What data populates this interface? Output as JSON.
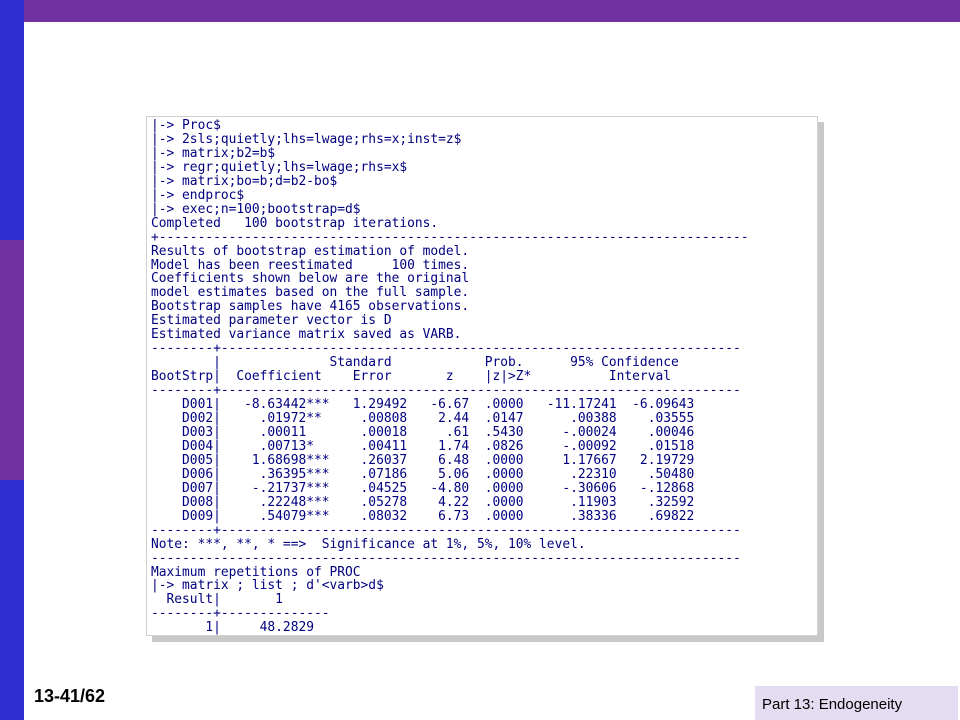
{
  "slide": {
    "number": "13-41/62",
    "footer": "Part 13: Endogeneity"
  },
  "colors": {
    "top_bar": "#7030a0",
    "side_blue": "#2f2fd0",
    "side_purple": "#7030a0",
    "console_text": "#000080",
    "footer_box": "#e4dcf0"
  },
  "console": {
    "lines": [
      "|-> Proc$",
      "|-> 2sls;quietly;lhs=lwage;rhs=x;inst=z$",
      "|-> matrix;b2=b$",
      "|-> regr;quietly;lhs=lwage;rhs=x$",
      "|-> matrix;bo=b;d=b2-bo$",
      "|-> endproc$",
      "|-> exec;n=100;bootstrap=d$",
      "Completed   100 bootstrap iterations.",
      "+----------------------------------------------------------------------------",
      "Results of bootstrap estimation of model.",
      "Model has been reestimated     100 times.",
      "Coefficients shown below are the original",
      "model estimates based on the full sample.",
      "Bootstrap samples have 4165 observations.",
      "Estimated parameter vector is D",
      "Estimated variance matrix saved as VARB.",
      "--------+-------------------------------------------------------------------",
      "        |              Standard            Prob.      95% Confidence",
      "BootStrp|  Coefficient    Error       z    |z|>Z*          Interval",
      "--------+-------------------------------------------------------------------",
      "    D001|   -8.63442***   1.29492   -6.67  .0000   -11.17241  -6.09643",
      "    D002|     .01972**     .00808    2.44  .0147      .00388    .03555",
      "    D003|     .00011       .00018     .61  .5430     -.00024    .00046",
      "    D004|     .00713*      .00411    1.74  .0826     -.00092    .01518",
      "    D005|    1.68698***    .26037    6.48  .0000     1.17667   2.19729",
      "    D006|     .36395***    .07186    5.06  .0000      .22310    .50480",
      "    D007|    -.21737***    .04525   -4.80  .0000     -.30606   -.12868",
      "    D008|     .22248***    .05278    4.22  .0000      .11903    .32592",
      "    D009|     .54079***    .08032    6.73  .0000      .38336    .69822",
      "--------+-------------------------------------------------------------------",
      "Note: ***, **, * ==>  Significance at 1%, 5%, 10% level.",
      "----------------------------------------------------------------------------",
      "Maximum repetitions of PROC",
      "|-> matrix ; list ; d'<varb>d$",
      "  Result|       1",
      "--------+--------------",
      "       1|     48.2829"
    ]
  }
}
